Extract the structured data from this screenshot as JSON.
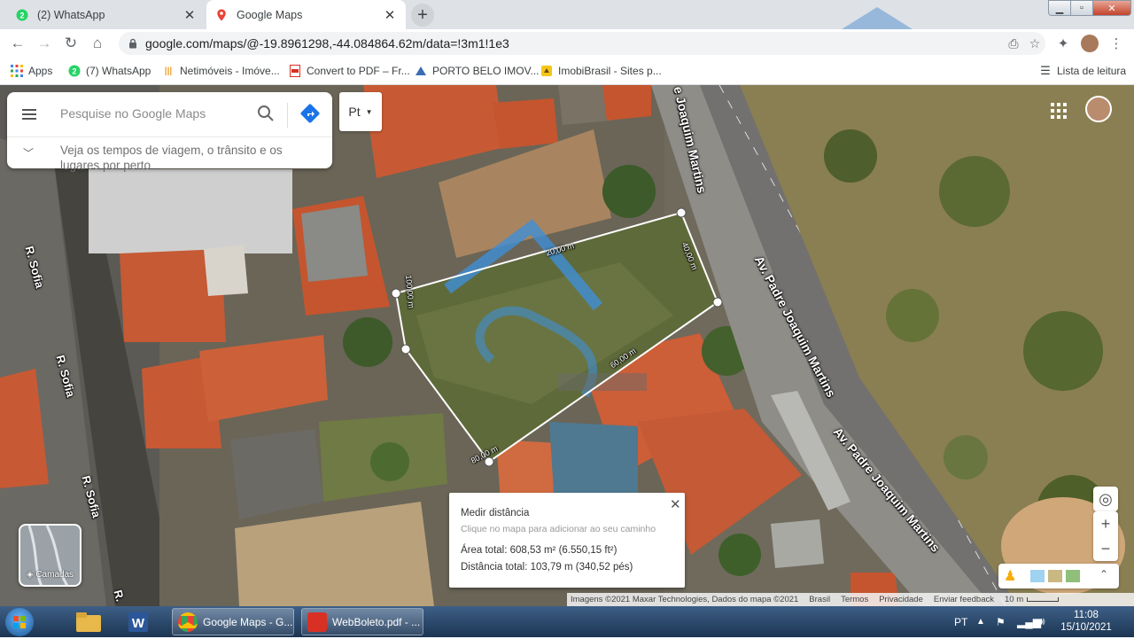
{
  "browser": {
    "tabs": [
      {
        "title": "(2) WhatsApp",
        "icon": "whatsapp-icon",
        "active": false
      },
      {
        "title": "Google Maps",
        "icon": "google-maps-icon",
        "active": true
      }
    ],
    "url": "google.com/maps/@-19.8961298,-44.084864.62m/data=!3m1!1e3",
    "bookmarks": [
      {
        "label": "Apps",
        "icon": "apps-grid-icon"
      },
      {
        "label": "(7) WhatsApp",
        "icon": "whatsapp-icon"
      },
      {
        "label": "Netimóveis - Imóve...",
        "icon": "netimoveis-icon"
      },
      {
        "label": "Convert to PDF – Fr...",
        "icon": "pdf-icon"
      },
      {
        "label": "PORTO BELO IMOV...",
        "icon": "porto-belo-icon"
      },
      {
        "label": "ImobiBrasil - Sites p...",
        "icon": "imobibrasil-icon"
      }
    ],
    "reading_list": "Lista de leitura"
  },
  "maps": {
    "search_placeholder": "Pesquise no Google Maps",
    "travel_hint": "Veja os tempos de viagem, o trânsito e os lugares por perto",
    "lang_button": "Pt",
    "layers_label": "Camadas",
    "street_labels": {
      "joaquim_top": "e Joaquim Martins",
      "padre_mid": "Av. Padre Joaquim Martins",
      "padre_low": "Av. Padre Joaquim Martins",
      "sofia_1": "R. Sofia",
      "sofia_2": "R. Sofia",
      "sofia_3": "R. Sofia",
      "r_bottom": "R."
    },
    "measure_segments": [
      "20,00 m",
      "40,00 m",
      "60,00 m",
      "80,00 m",
      "100,00 m"
    ],
    "measure_panel": {
      "title": "Medir distância",
      "subtitle": "Clique no mapa para adicionar ao seu caminho",
      "area": "Área total: 608,53 m² (6.550,15 ft²)",
      "distance": "Distância total: 103,79 m (340,52 pés)"
    },
    "attribution": [
      "Imagens ©2021 Maxar Technologies, Dados do mapa ©2021",
      "Brasil",
      "Termos",
      "Privacidade",
      "Enviar feedback",
      "10 m"
    ]
  },
  "taskbar": {
    "tasks": [
      "Google Maps - G...",
      "WebBoleto.pdf - ..."
    ],
    "language": "PT",
    "time": "11:08",
    "date": "15/10/2021"
  }
}
